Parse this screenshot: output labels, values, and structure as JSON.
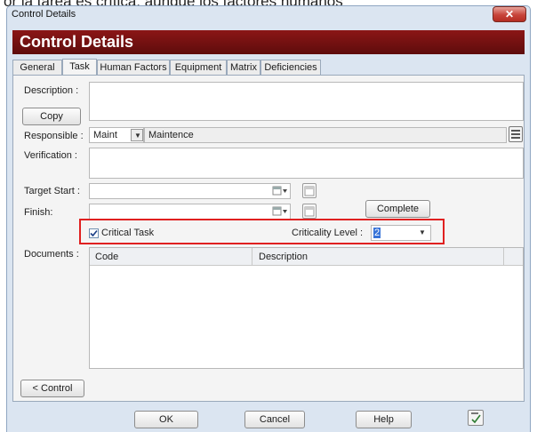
{
  "caption_fragment": "or la tarea es crítica, aunque los factores humanos",
  "window": {
    "title": "Control Details",
    "close_glyph": "✕"
  },
  "header": {
    "title": "Control Details"
  },
  "tabs": [
    {
      "label": "General"
    },
    {
      "label": "Task"
    },
    {
      "label": "Human Factors"
    },
    {
      "label": "Equipment"
    },
    {
      "label": "Matrix"
    },
    {
      "label": "Deficiencies"
    }
  ],
  "active_tab": "Task",
  "form": {
    "description_label": "Description :",
    "copy_label": "Copy",
    "responsible_label": "Responsible :",
    "responsible_code": "Maint",
    "responsible_name": "Maintence",
    "verification_label": "Verification :",
    "target_start_label": "Target Start :",
    "finish_label": "Finish:",
    "complete_label": "Complete",
    "critical_task_label": "Critical Task",
    "critical_task_checked": true,
    "criticality_level_label": "Criticality Level :",
    "criticality_level_value": "2",
    "documents_label": "Documents :",
    "documents_columns": [
      "Code",
      "Description"
    ],
    "control_back_label": "< Control"
  },
  "footer": {
    "ok_label": "OK",
    "cancel_label": "Cancel",
    "help_label": "Help"
  },
  "icons": [
    "close-icon",
    "calendar-icon",
    "combo-arrow-icon",
    "spellcheck-icon",
    "lookup-list-icon"
  ],
  "colors": {
    "header_bg": "#7a1212",
    "highlight_border": "#e02020",
    "window_bg": "#dbe5f1"
  }
}
